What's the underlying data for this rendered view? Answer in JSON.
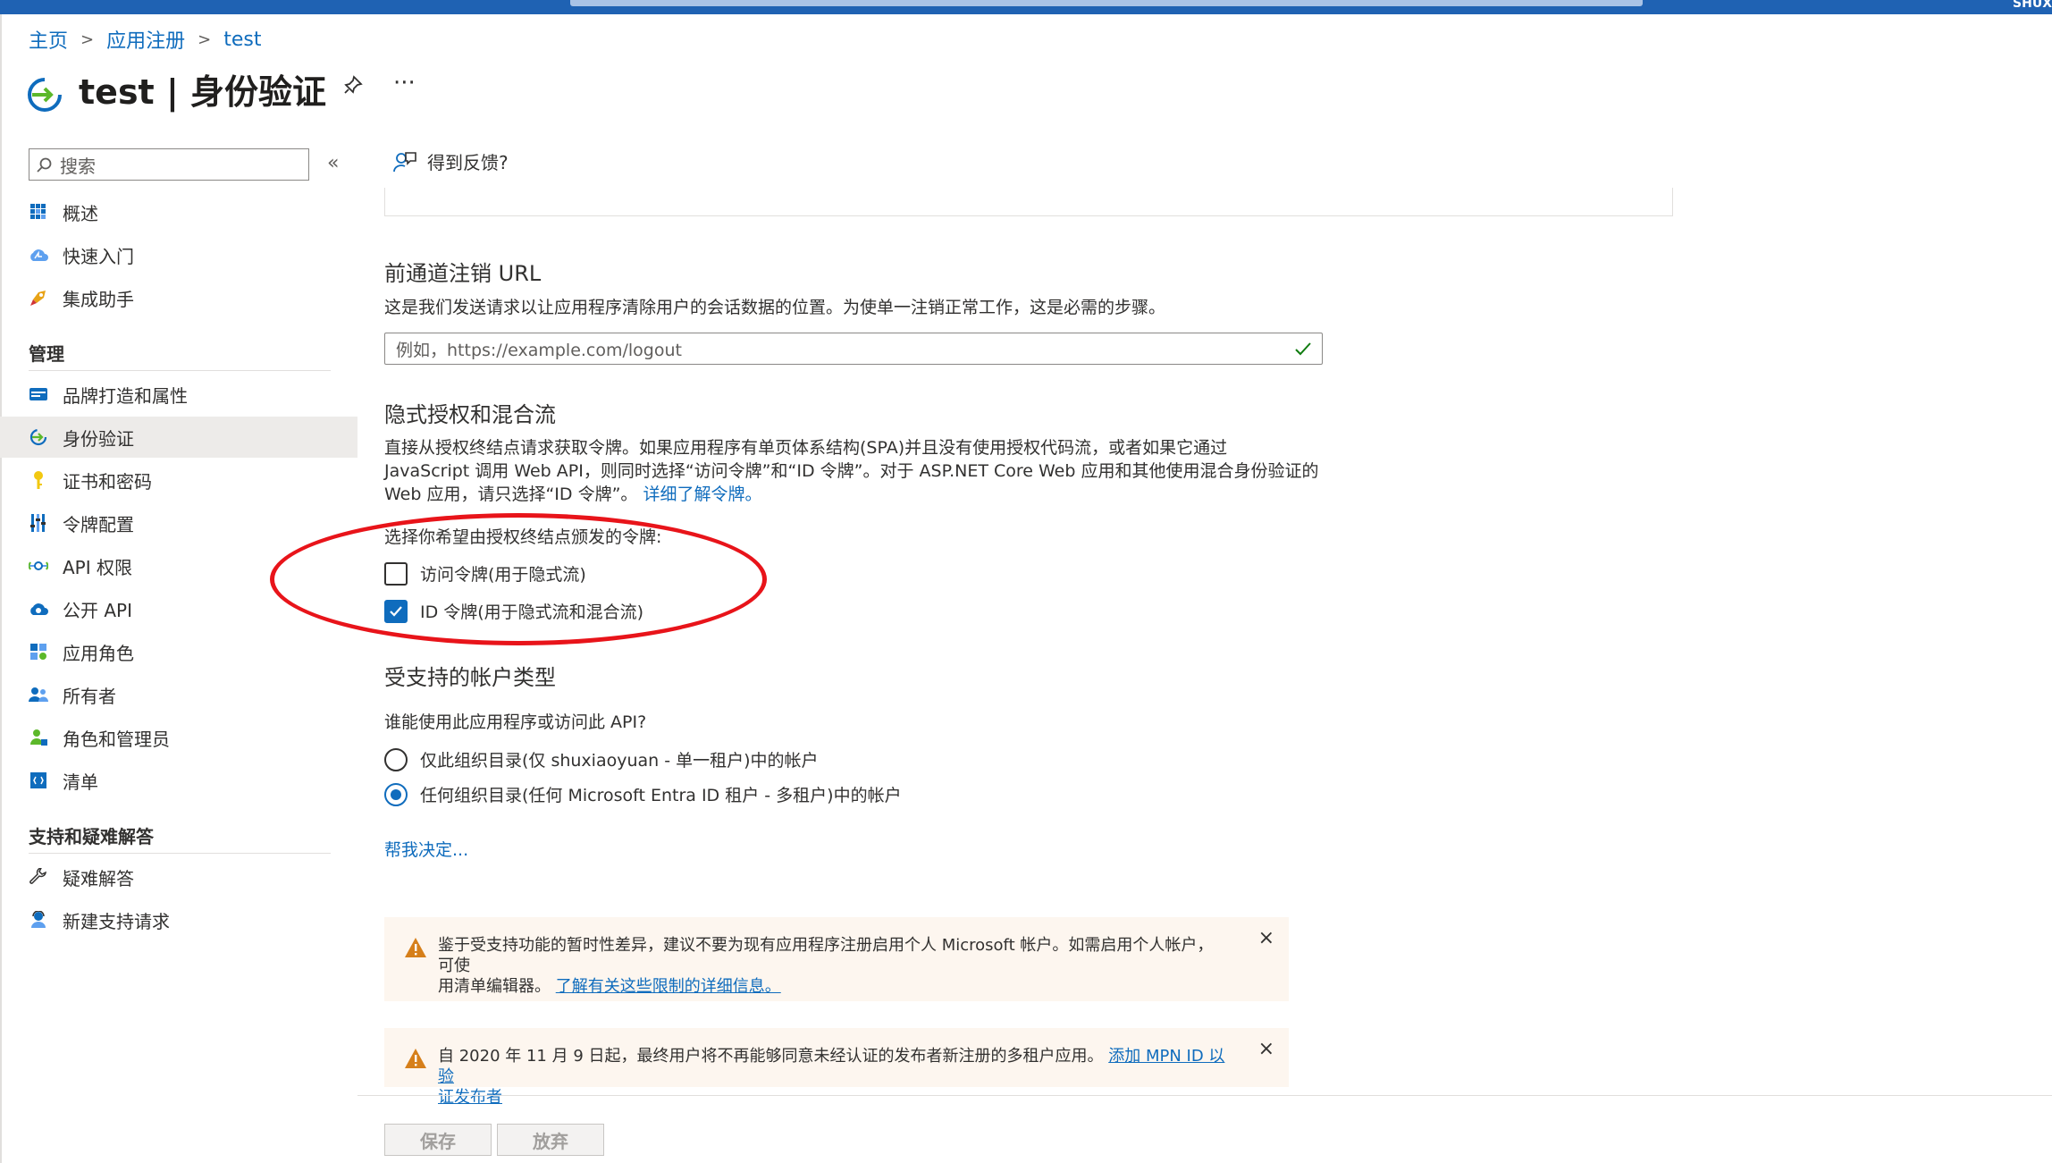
{
  "topbar": {
    "user": "SHUX"
  },
  "breadcrumb": {
    "home": "主页",
    "app_reg": "应用注册",
    "current": "test"
  },
  "header": {
    "title": "test | 身份验证"
  },
  "sidebar": {
    "search_placeholder": "搜索",
    "collapse": "«",
    "items_top": [
      {
        "label": "概述",
        "icon": "overview-grid-icon"
      },
      {
        "label": "快速入门",
        "icon": "cloud-quickstart-icon"
      },
      {
        "label": "集成助手",
        "icon": "rocket-icon"
      }
    ],
    "section_manage": "管理",
    "items_manage": [
      {
        "label": "品牌打造和属性",
        "icon": "branding-card-icon"
      },
      {
        "label": "身份验证",
        "icon": "authentication-icon",
        "active": true
      },
      {
        "label": "证书和密码",
        "icon": "key-icon"
      },
      {
        "label": "令牌配置",
        "icon": "token-bars-icon"
      },
      {
        "label": "API 权限",
        "icon": "api-permission-icon"
      },
      {
        "label": "公开 API",
        "icon": "cloud-api-icon"
      },
      {
        "label": "应用角色",
        "icon": "app-roles-icon"
      },
      {
        "label": "所有者",
        "icon": "owners-icon"
      },
      {
        "label": "角色和管理员",
        "icon": "roles-admins-icon"
      },
      {
        "label": "清单",
        "icon": "manifest-icon"
      }
    ],
    "section_support": "支持和疑难解答",
    "items_support": [
      {
        "label": "疑难解答",
        "icon": "wrench-icon"
      },
      {
        "label": "新建支持请求",
        "icon": "support-person-icon"
      }
    ]
  },
  "main": {
    "feedback": "得到反馈?",
    "logout": {
      "heading": "前通道注销 URL",
      "desc": "这是我们发送请求以让应用程序清除用户的会话数据的位置。为使单一注销正常工作，这是必需的步骤。",
      "placeholder": "例如，https://example.com/logout"
    },
    "implicit": {
      "heading": "隐式授权和混合流",
      "desc1": "直接从授权终结点请求获取令牌。如果应用程序有单页体系结构(SPA)并且没有使用授权代码流，或者如果它通过",
      "desc2": "JavaScript 调用 Web API，则同时选择“访问令牌”和“ID 令牌”。对于 ASP.NET Core Web 应用和其他使用混合身份验证的",
      "desc3": "Web 应用，请只选择“ID 令牌”。",
      "learn_more": "详细了解令牌。",
      "select_label": "选择你希望由授权终结点颁发的令牌:",
      "access_token": {
        "label": "访问令牌(用于隐式流)",
        "checked": false
      },
      "id_token": {
        "label": "ID 令牌(用于隐式流和混合流)",
        "checked": true
      }
    },
    "accounts": {
      "heading": "受支持的帐户类型",
      "question": "谁能使用此应用程序或访问此 API?",
      "option_single": "仅此组织目录(仅 shuxiaoyuan - 单一租户)中的帐户",
      "option_multi": "任何组织目录(任何 Microsoft Entra ID 租户 - 多租户)中的帐户",
      "selected": "option_multi",
      "help": "帮我决定..."
    },
    "warning1": {
      "line1": "鉴于受支持功能的暂时性差异，建议不要为现有应用程序注册启用个人 Microsoft 帐户。如需启用个人帐户，可使",
      "line2": "用清单编辑器。",
      "link": "了解有关这些限制的详细信息。"
    },
    "warning2": {
      "text": "自 2020 年 11 月 9 日起，最终用户将不再能够同意未经认证的发布者新注册的多租户应用。",
      "link1": "添加 MPN ID 以验",
      "link2": "证发布者"
    }
  },
  "footer": {
    "save": "保存",
    "discard": "放弃"
  },
  "colors": {
    "accent": "#0f6cbd",
    "annotation": "#e8141a",
    "warning_bg": "#fdf6ef",
    "warning_icon": "#d67f1a"
  }
}
